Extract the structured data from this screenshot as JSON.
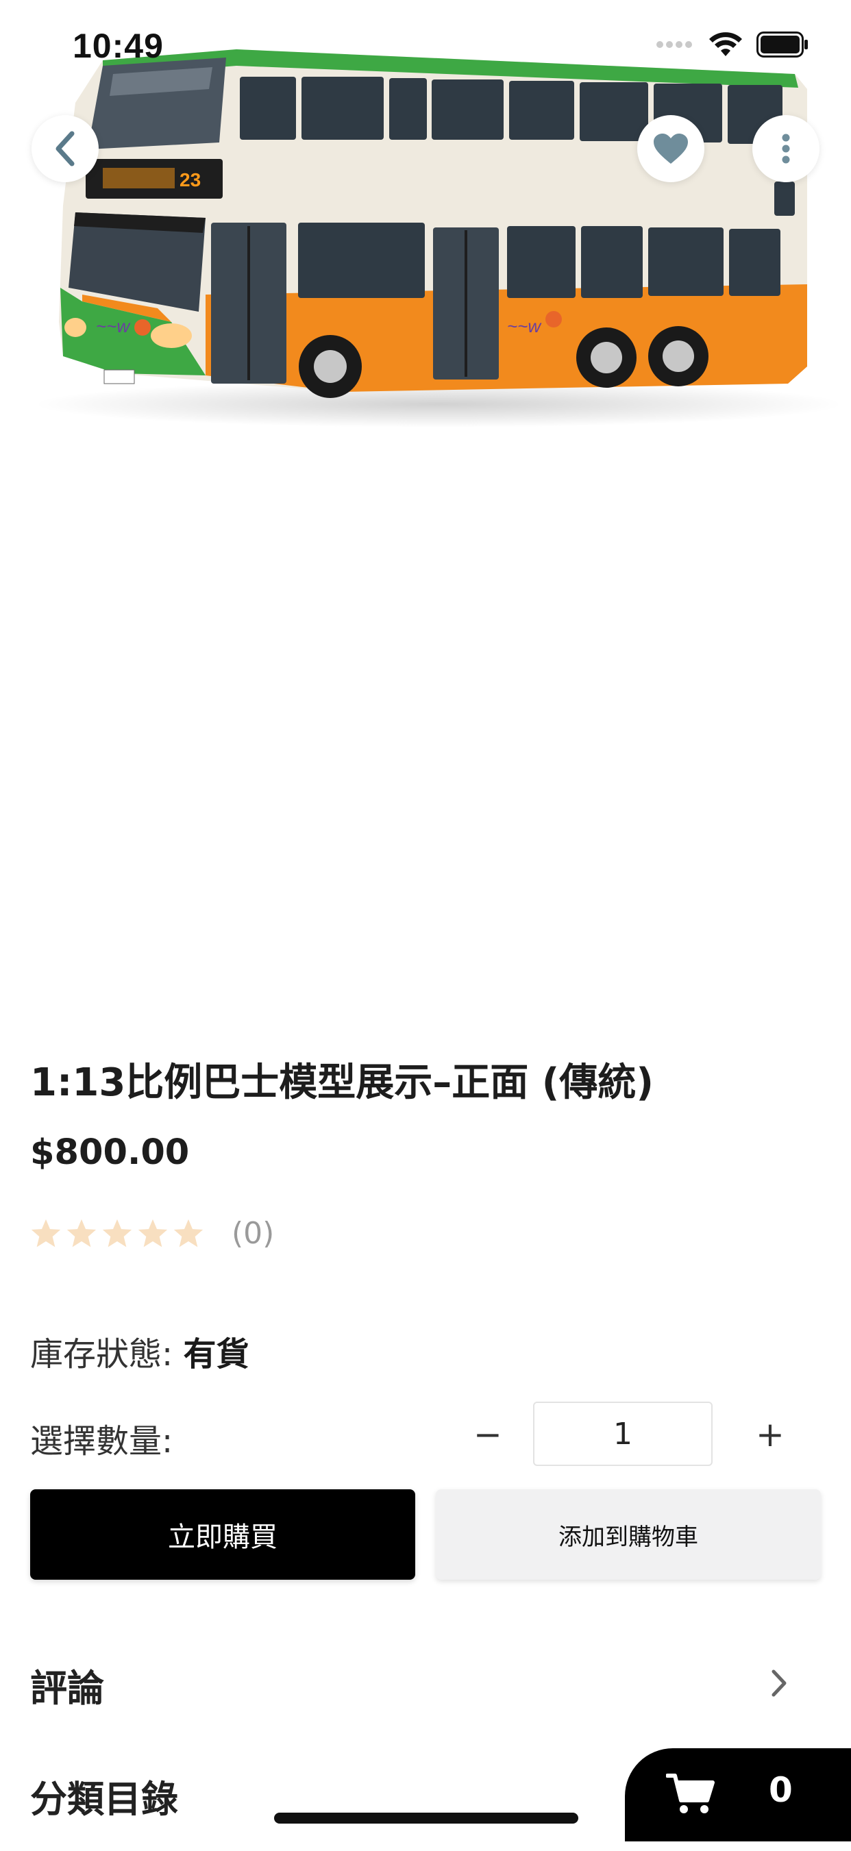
{
  "status_bar": {
    "time": "10:49"
  },
  "product": {
    "title": "1:13比例巴士模型展示–正面 (傳統)",
    "price": "$800.00",
    "review_count": "(0)",
    "rating_stars": 5,
    "star_color": "#f8dfc0"
  },
  "stock": {
    "label": "庫存狀態:",
    "value": "有貨"
  },
  "quantity": {
    "label": "選擇數量:",
    "minus": "−",
    "value": "1",
    "plus": "+"
  },
  "actions": {
    "buy_now": "立即購買",
    "add_to_cart": "添加到購物車"
  },
  "sections": {
    "reviews": "評論",
    "category": "分類目錄"
  },
  "cart": {
    "count": "0"
  },
  "icons": {
    "back": "chevron-left-icon",
    "favorite": "heart-icon",
    "more": "more-vertical-icon",
    "cart": "cart-icon",
    "chevron": "chevron-right-icon"
  },
  "colors": {
    "primary_button": "#000000",
    "secondary_button": "#f1f1f2",
    "bus_green": "#3ea844",
    "bus_orange": "#f28a1d",
    "bus_cream": "#efeadf"
  }
}
